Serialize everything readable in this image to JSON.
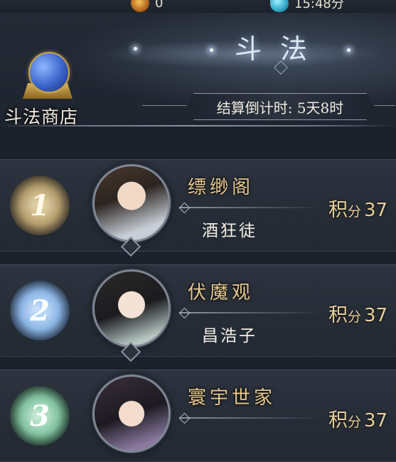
{
  "top_resources": [
    {
      "icon": "gold-coin-icon",
      "value": "0"
    },
    {
      "icon": "jade-crystal-icon",
      "value": "15:48分"
    }
  ],
  "header": {
    "title": "斗法",
    "shop_label": "斗法商店",
    "countdown": "结算倒计时: 5天8时"
  },
  "ranking": [
    {
      "rank": "1",
      "guild": "缥缈阁",
      "leader": "酒狂徒",
      "score_label_a": "积",
      "score_label_b": "分",
      "score": "37"
    },
    {
      "rank": "2",
      "guild": "伏魔观",
      "leader": "昌浩子",
      "score_label_a": "积",
      "score_label_b": "分",
      "score": "37"
    },
    {
      "rank": "3",
      "guild": "寰宇世家",
      "leader": "",
      "score_label_a": "积",
      "score_label_b": "分",
      "score": "37"
    }
  ],
  "colors": {
    "background": "#1c222b",
    "guild_name": "#e7c98e",
    "score": "#e9cf98",
    "rank1": "#d6b56f",
    "rank2": "#8cc1ff",
    "rank3": "#8fdcb3"
  }
}
